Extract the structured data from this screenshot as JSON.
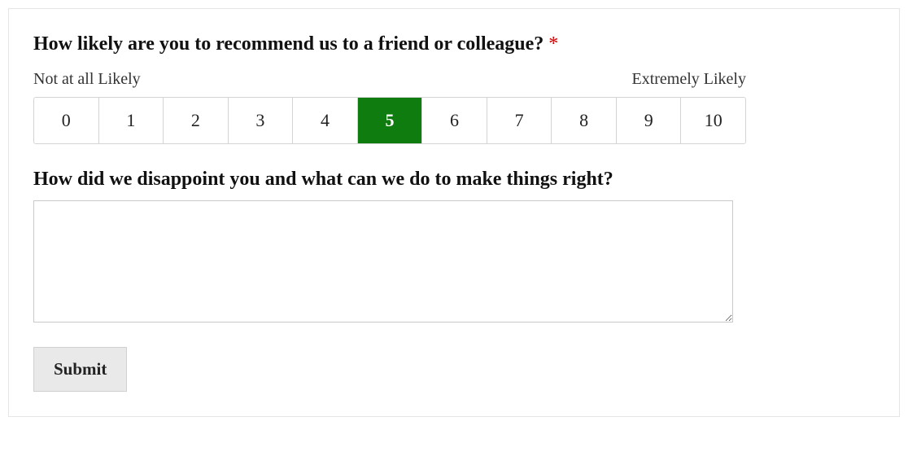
{
  "question1": {
    "label": "How likely are you to recommend us to a friend or colleague?",
    "required_marker": "*",
    "low_label": "Not at all Likely",
    "high_label": "Extremely Likely",
    "options": [
      "0",
      "1",
      "2",
      "3",
      "4",
      "5",
      "6",
      "7",
      "8",
      "9",
      "10"
    ],
    "selected_value": "5"
  },
  "question2": {
    "label": "How did we disappoint you and what can we do to make things right?",
    "value": "",
    "placeholder": ""
  },
  "submit": {
    "label": "Submit"
  }
}
